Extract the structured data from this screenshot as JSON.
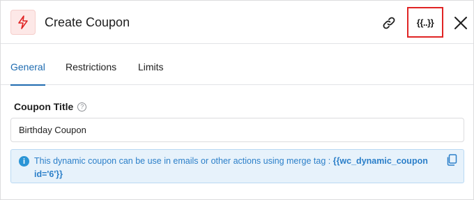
{
  "header": {
    "title": "Create Coupon",
    "icon": "lightning-icon",
    "merge_tag_button": "{{..}}",
    "accent_color": "#e02424"
  },
  "tabs": [
    {
      "label": "General",
      "active": true
    },
    {
      "label": "Restrictions",
      "active": false
    },
    {
      "label": "Limits",
      "active": false
    }
  ],
  "form": {
    "coupon_title_label": "Coupon Title",
    "coupon_title_value": "Birthday Coupon"
  },
  "notice": {
    "text": "This dynamic coupon can be use in emails or other actions using merge tag : ",
    "merge_tag": "{{wc_dynamic_coupon id='6'}}"
  },
  "colors": {
    "link": "#1e6bb0",
    "notice_bg": "#e7f2fb",
    "notice_text": "#2b7fc9"
  }
}
